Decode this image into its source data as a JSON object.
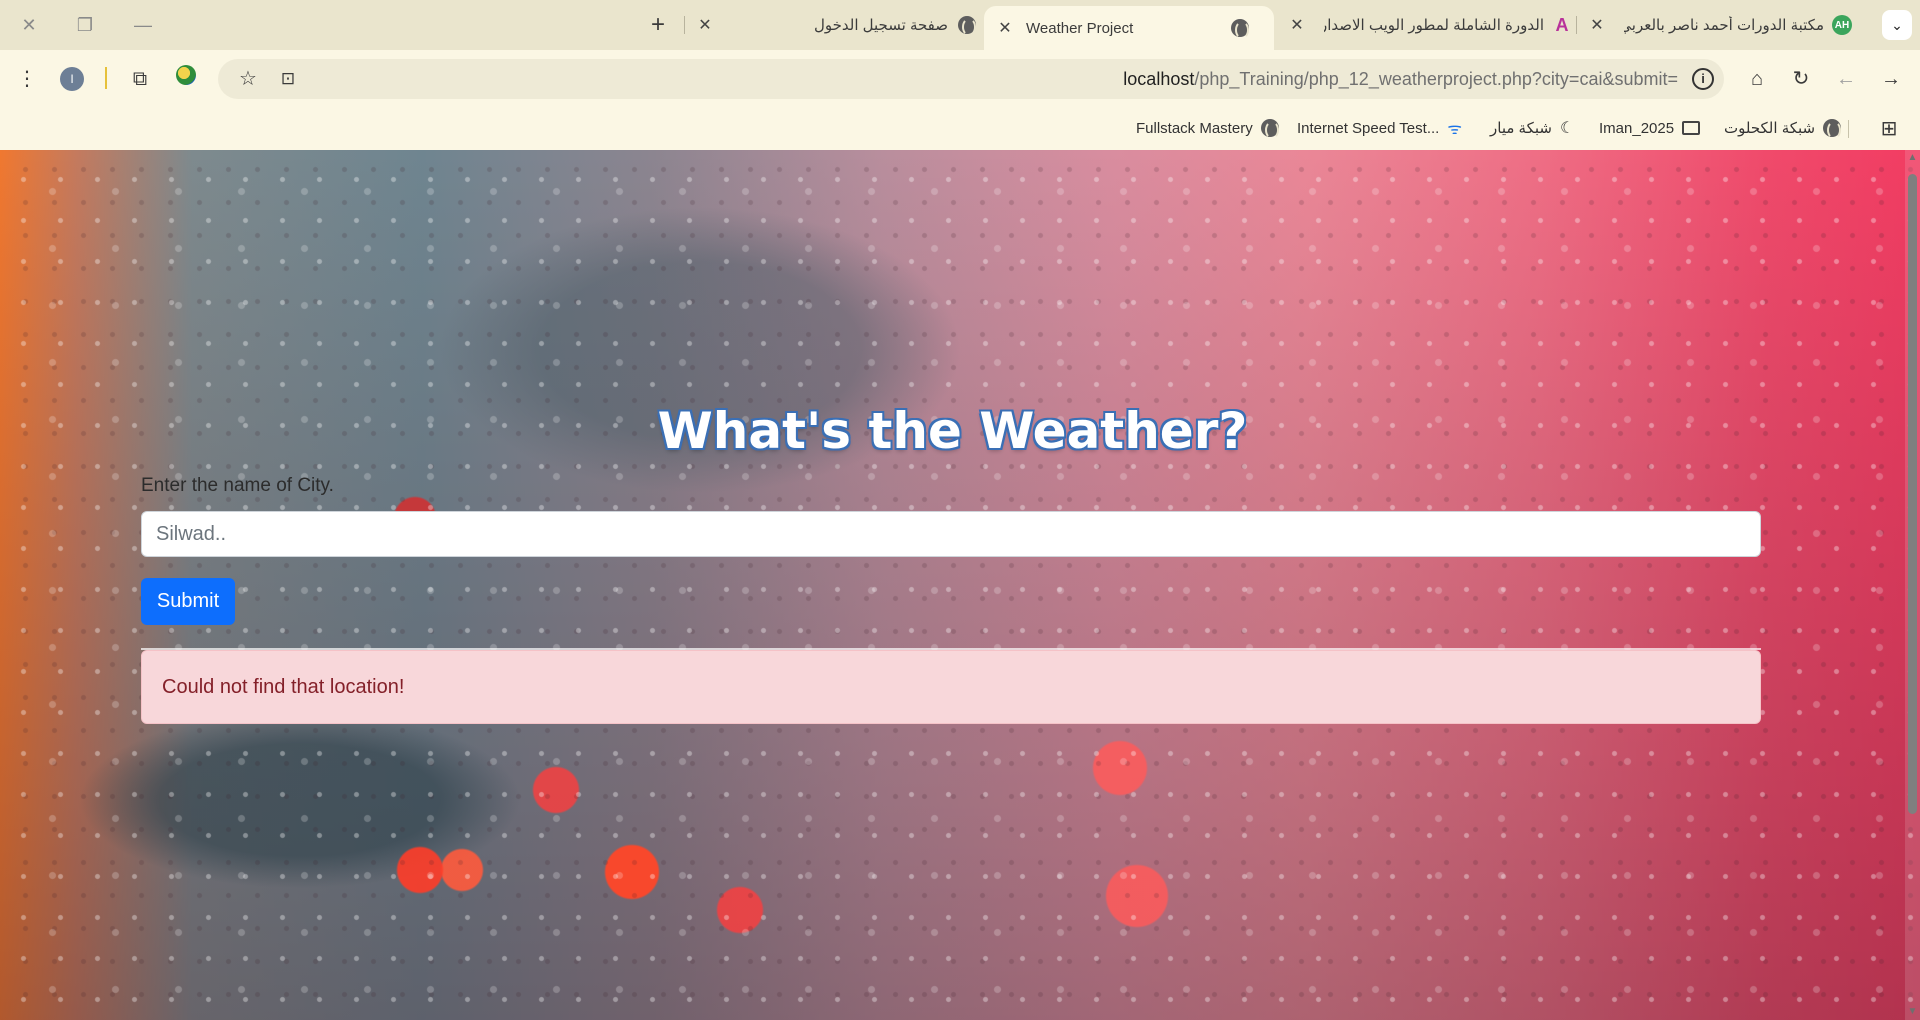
{
  "tabs": [
    {
      "title": "مكتبة الدورات أحمد ناصر بالعربي",
      "favicon": "AH"
    },
    {
      "title": "الدورة الشاملة لمطور الويب الاصدار",
      "favicon": "A"
    },
    {
      "title": "Weather Project",
      "favicon": "globe",
      "active": true
    },
    {
      "title": "صفحة تسجيل الدخول",
      "favicon": "globe"
    }
  ],
  "new_tab_label": "+",
  "address_bar": {
    "host": "localhost",
    "path": "/php_Training/php_12_weatherproject.php?city=cai&submit="
  },
  "profile_initial": "I",
  "bookmarks": [
    {
      "label": "شبكة الكحلوت",
      "icon": "globe-icon"
    },
    {
      "label": "Iman_2025",
      "icon": "folder-icon"
    },
    {
      "label": "شبكة ميار",
      "icon": "moon-icon"
    },
    {
      "label": "Internet Speed Test...",
      "icon": "wifi-icon"
    },
    {
      "label": "Fullstack Mastery",
      "icon": "globe-icon"
    }
  ],
  "page": {
    "heading": "What's the Weather?",
    "city_label": "Enter the name of City.",
    "city_placeholder": "Silwad..",
    "submit_label": "Submit",
    "error_message": "Could not find that location!"
  },
  "colors": {
    "primary_button": "#0d6efd",
    "alert_bg": "#f8d7da",
    "alert_text": "#842029",
    "heading_outline": "#3a6fb5"
  }
}
